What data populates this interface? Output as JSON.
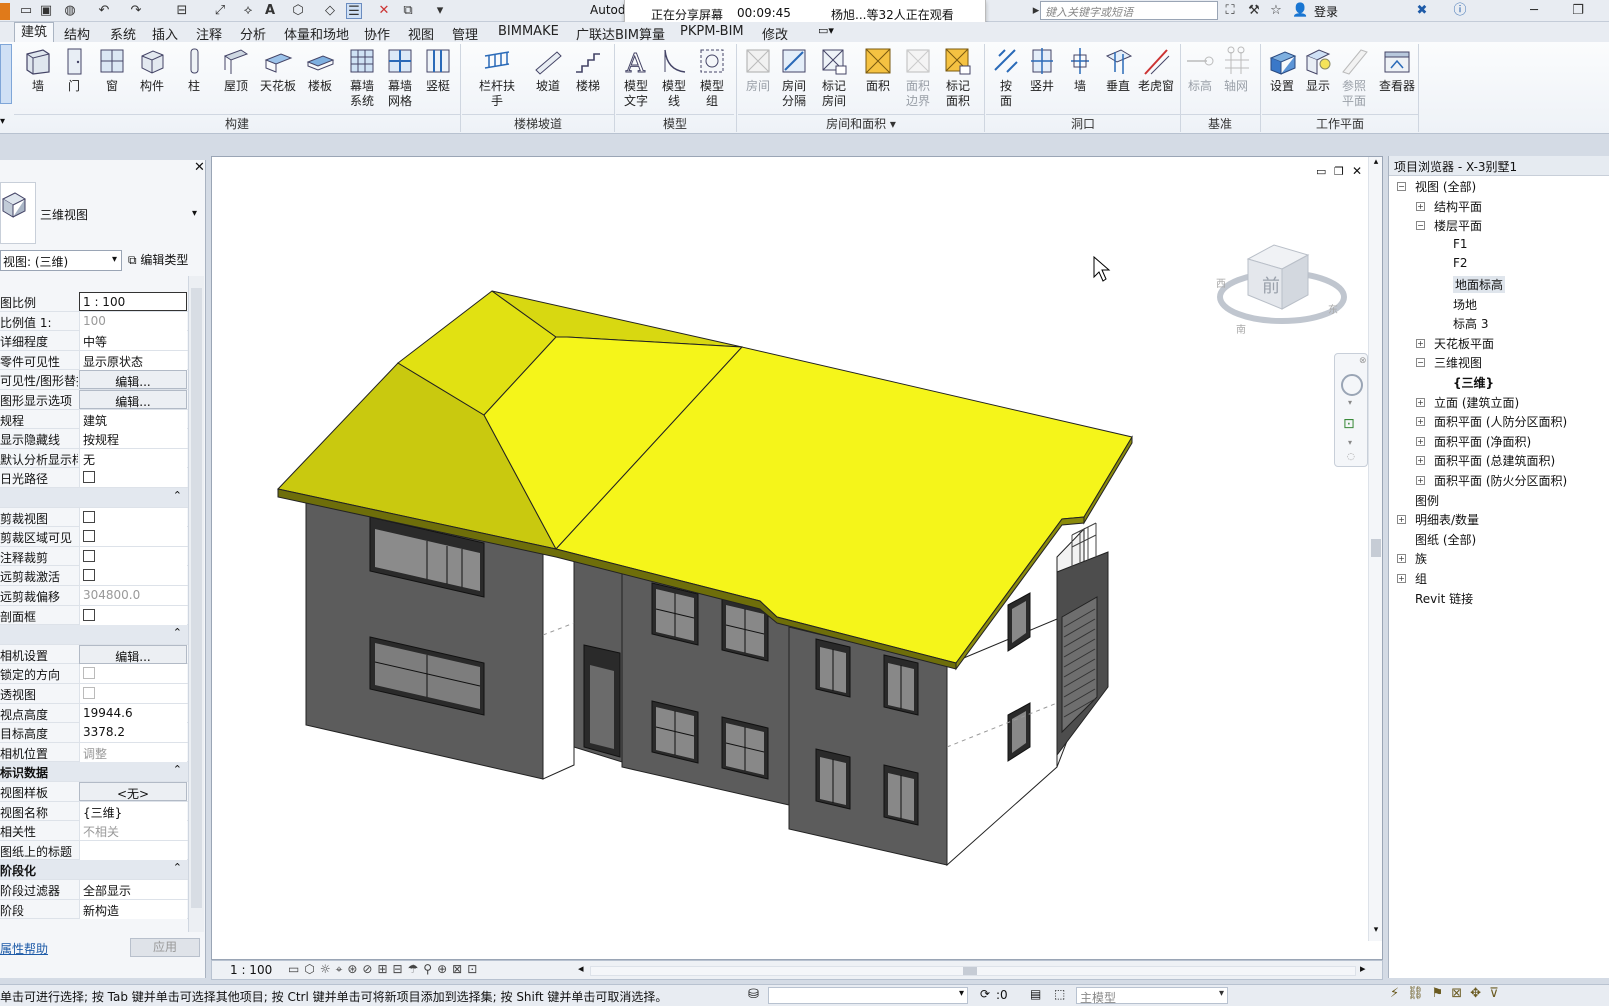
{
  "titlebar": {
    "app_title": "Autod",
    "share": {
      "status": "正在分享屏幕",
      "timer": "00:09:45",
      "viewers": "杨旭...等32人正在观看"
    },
    "search_placeholder": "键入关键字或短语",
    "login": "登录"
  },
  "menu_tabs": [
    "建筑",
    "结构",
    "系统",
    "插入",
    "注释",
    "分析",
    "体量和场地",
    "协作",
    "视图",
    "管理",
    "BIMMAKE",
    "广联达BIM算量",
    "PKPM-BIM",
    "修改"
  ],
  "ribbon": {
    "groups": {
      "build": "构建",
      "stairs": "楼梯坡道",
      "model": "模型",
      "room": "房间和面积",
      "opening": "洞口",
      "datum": "基准",
      "workplane": "工作平面"
    },
    "build_buttons": [
      "墙",
      "门",
      "窗",
      "构件",
      "柱",
      "屋顶",
      "天花板",
      "楼板",
      "幕墙\n系统",
      "幕墙\n网格",
      "竖梃"
    ],
    "stairs_buttons": [
      "栏杆扶手",
      "坡道",
      "楼梯"
    ],
    "model_buttons": [
      "模型\n文字",
      "模型\n线",
      "模型\n组"
    ],
    "room_buttons": [
      "房间",
      "房间\n分隔",
      "标记\n房间",
      "面积",
      "面积\n边界",
      "标记\n面积"
    ],
    "opening_buttons": [
      "按\n面",
      "竖井",
      "墙",
      "垂直",
      "老虎窗"
    ],
    "datum_buttons": [
      "标高",
      "轴网"
    ],
    "workplane_buttons": [
      "设置",
      "显示",
      "参照\n平面",
      "查看器"
    ]
  },
  "properties": {
    "type_name": "三维视图",
    "view_selector": "视图: (三维)",
    "edit_type": "编辑类型",
    "rows": [
      {
        "k": "图比例",
        "v": "1 : 100",
        "kind": "input"
      },
      {
        "k": "比例值 1:",
        "v": "100",
        "kind": "grey"
      },
      {
        "k": "详细程度",
        "v": "中等"
      },
      {
        "k": "零件可见性",
        "v": "显示原状态"
      },
      {
        "k": "可见性/图形替换",
        "v": "编辑...",
        "kind": "btn"
      },
      {
        "k": "图形显示选项",
        "v": "编辑...",
        "kind": "btn"
      },
      {
        "k": "规程",
        "v": "建筑"
      },
      {
        "k": "显示隐藏线",
        "v": "按规程"
      },
      {
        "k": "默认分析显示样式",
        "v": "无"
      },
      {
        "k": "日光路径",
        "v": "",
        "kind": "chk"
      },
      {
        "k": "",
        "v": "",
        "kind": "sect"
      },
      {
        "k": "剪裁视图",
        "v": "",
        "kind": "chk"
      },
      {
        "k": "剪裁区域可见",
        "v": "",
        "kind": "chk"
      },
      {
        "k": "注释裁剪",
        "v": "",
        "kind": "chk"
      },
      {
        "k": "远剪裁激活",
        "v": "",
        "kind": "chk"
      },
      {
        "k": "远剪裁偏移",
        "v": "304800.0",
        "kind": "grey"
      },
      {
        "k": "剖面框",
        "v": "",
        "kind": "chk"
      },
      {
        "k": "",
        "v": "",
        "kind": "sect"
      },
      {
        "k": "相机设置",
        "v": "编辑...",
        "kind": "btn"
      },
      {
        "k": "锁定的方向",
        "v": "",
        "kind": "chkdis"
      },
      {
        "k": "透视图",
        "v": "",
        "kind": "chkdis"
      },
      {
        "k": "视点高度",
        "v": "19944.6"
      },
      {
        "k": "目标高度",
        "v": "3378.2"
      },
      {
        "k": "相机位置",
        "v": "调整",
        "kind": "grey"
      },
      {
        "k": "标识数据",
        "v": "",
        "kind": "sect"
      },
      {
        "k": "视图样板",
        "v": "<无>",
        "kind": "btn"
      },
      {
        "k": "视图名称",
        "v": "{三维}"
      },
      {
        "k": "相关性",
        "v": "不相关",
        "kind": "grey"
      },
      {
        "k": "图纸上的标题",
        "v": ""
      },
      {
        "k": "阶段化",
        "v": "",
        "kind": "sect"
      },
      {
        "k": "阶段过滤器",
        "v": "全部显示"
      },
      {
        "k": "阶段",
        "v": "新构造"
      }
    ],
    "help_link": "属性帮助",
    "apply": "应用"
  },
  "viewcube": {
    "face": "前",
    "compass_s": "南",
    "compass_e": "东",
    "compass_w": "西"
  },
  "browser": {
    "title": "项目浏览器 - X-3别墅1",
    "nodes": [
      {
        "label": "视图 (全部)",
        "level": 0,
        "box": "−"
      },
      {
        "label": "结构平面",
        "level": 1,
        "box": "+"
      },
      {
        "label": "楼层平面",
        "level": 1,
        "box": "−"
      },
      {
        "label": "F1",
        "level": 2
      },
      {
        "label": "F2",
        "level": 2
      },
      {
        "label": "地面标高",
        "level": 2,
        "selected": true
      },
      {
        "label": "场地",
        "level": 2
      },
      {
        "label": "标高 3",
        "level": 2
      },
      {
        "label": "天花板平面",
        "level": 1,
        "box": "+"
      },
      {
        "label": "三维视图",
        "level": 1,
        "box": "−"
      },
      {
        "label": "{三维}",
        "level": 2,
        "bold": true
      },
      {
        "label": "立面 (建筑立面)",
        "level": 1,
        "box": "+"
      },
      {
        "label": "面积平面 (人防分区面积)",
        "level": 1,
        "box": "+"
      },
      {
        "label": "面积平面 (净面积)",
        "level": 1,
        "box": "+"
      },
      {
        "label": "面积平面 (总建筑面积)",
        "level": 1,
        "box": "+"
      },
      {
        "label": "面积平面 (防火分区面积)",
        "level": 1,
        "box": "+"
      },
      {
        "label": "图例",
        "level": 0
      },
      {
        "label": "明细表/数量",
        "level": 0,
        "box": "+"
      },
      {
        "label": "图纸 (全部)",
        "level": 0
      },
      {
        "label": "族",
        "level": 0,
        "box": "+"
      },
      {
        "label": "组",
        "level": 0,
        "box": "+"
      },
      {
        "label": "Revit 链接",
        "level": 0
      }
    ]
  },
  "viewbar": {
    "scale": "1 : 100"
  },
  "statusbar": {
    "message": "单击可进行选择; 按 Tab 键并单击可选择其他项目; 按 Ctrl 键并单击可将新项目添加到选择集; 按 Shift 键并单击可取消选择。",
    "zero": ":0",
    "model": "主模型"
  },
  "colors": {
    "roof": "#f5f51a",
    "roof_dark": "#c9c90f",
    "wall": "#5c5c5c",
    "wall_light": "#ffffff",
    "accent": "#1e5ba8"
  }
}
